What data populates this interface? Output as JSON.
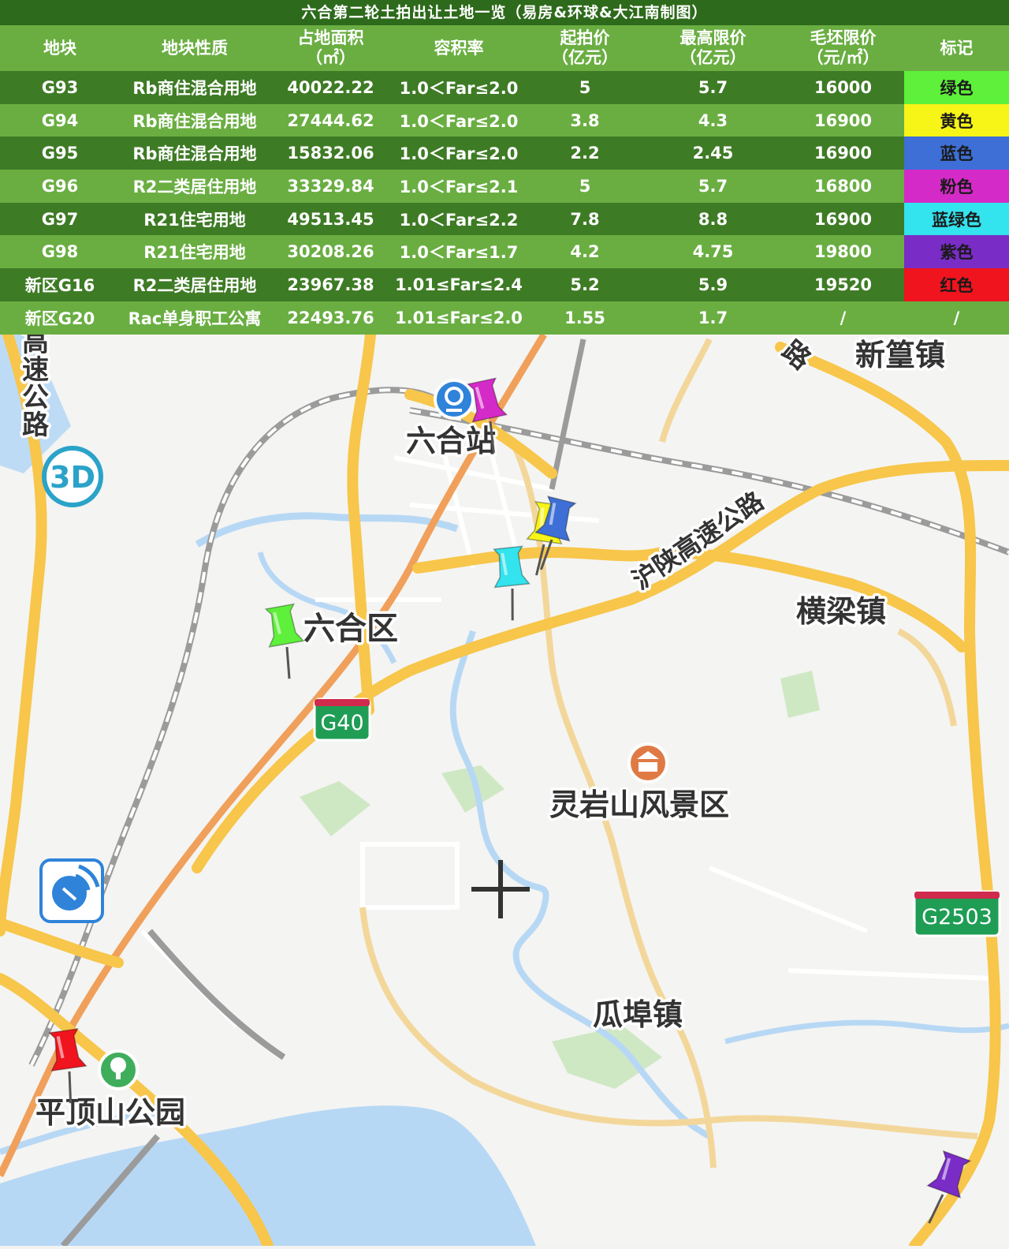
{
  "title": "六合第二轮土拍出让土地一览（易房&环球&大江南制图）",
  "table": {
    "headers": [
      {
        "line1": "地块",
        "line2": ""
      },
      {
        "line1": "地块性质",
        "line2": ""
      },
      {
        "line1": "占地面积",
        "line2": "（㎡）"
      },
      {
        "line1": "容积率",
        "line2": ""
      },
      {
        "line1": "起拍价",
        "line2": "（亿元）"
      },
      {
        "line1": "最高限价",
        "line2": "（亿元）"
      },
      {
        "line1": "毛坯限价",
        "line2": "（元/㎡）"
      },
      {
        "line1": "标记",
        "line2": ""
      }
    ],
    "rows": [
      {
        "id": "G93",
        "type": "Rb商住混合用地",
        "area": "40022.22",
        "far": "1.0＜Far≤2.0",
        "start": "5",
        "max": "5.7",
        "limit": "16000",
        "mark": "绿色",
        "color": "#5ef03a"
      },
      {
        "id": "G94",
        "type": "Rb商住混合用地",
        "area": "27444.62",
        "far": "1.0＜Far≤2.0",
        "start": "3.8",
        "max": "4.3",
        "limit": "16900",
        "mark": "黄色",
        "color": "#f7f417"
      },
      {
        "id": "G95",
        "type": "Rb商住混合用地",
        "area": "15832.06",
        "far": "1.0＜Far≤2.0",
        "start": "2.2",
        "max": "2.45",
        "limit": "16900",
        "mark": "蓝色",
        "color": "#3d6fd6"
      },
      {
        "id": "G96",
        "type": "R2二类居住用地",
        "area": "33329.84",
        "far": "1.0＜Far≤2.1",
        "start": "5",
        "max": "5.7",
        "limit": "16800",
        "mark": "粉色",
        "color": "#d42ac8"
      },
      {
        "id": "G97",
        "type": "R21住宅用地",
        "area": "49513.45",
        "far": "1.0＜Far≤2.2",
        "start": "7.8",
        "max": "8.8",
        "limit": "16900",
        "mark": "蓝绿色",
        "color": "#33e3ee"
      },
      {
        "id": "G98",
        "type": "R21住宅用地",
        "area": "30208.26",
        "far": "1.0＜Far≤1.7",
        "start": "4.2",
        "max": "4.75",
        "limit": "19800",
        "mark": "紫色",
        "color": "#7a2cc6"
      },
      {
        "id": "新区G16",
        "type": "R2二类居住用地",
        "area": "23967.38",
        "far": "1.01≤Far≤2.4",
        "start": "5.2",
        "max": "5.9",
        "limit": "19520",
        "mark": "红色",
        "color": "#f0141e"
      },
      {
        "id": "新区G20",
        "type": "Rac单身职工公寓",
        "area": "22493.76",
        "far": "1.01≤Far≤2.0",
        "start": "1.55",
        "max": "1.7",
        "limit": "/",
        "mark": "/",
        "color": "#6aae42"
      }
    ]
  },
  "map": {
    "labels": {
      "xinhuang": "新篁镇",
      "luhe_station": "六合站",
      "luhe_district": "六合区",
      "hengliang": "横梁镇",
      "lingyan": "灵岩山风景区",
      "guabu": "瓜埠镇",
      "pingdingshan": "平顶山公园",
      "hushan": "沪陕高速公路",
      "gongjia_top": "路",
      "expressway_left": [
        "高",
        "速",
        "公",
        "路"
      ]
    },
    "shields": {
      "g40": "G40",
      "g2503": "G2503"
    },
    "buttons": {
      "three_d": "3D"
    },
    "pins": [
      {
        "name": "pin-pink",
        "color": "#d42ac8"
      },
      {
        "name": "pin-yellow",
        "color": "#f7f417"
      },
      {
        "name": "pin-blue",
        "color": "#3d6fd6"
      },
      {
        "name": "pin-teal",
        "color": "#33e3ee"
      },
      {
        "name": "pin-green",
        "color": "#5ef03a"
      },
      {
        "name": "pin-red",
        "color": "#f0141e"
      },
      {
        "name": "pin-purple",
        "color": "#7a2cc6"
      }
    ]
  }
}
